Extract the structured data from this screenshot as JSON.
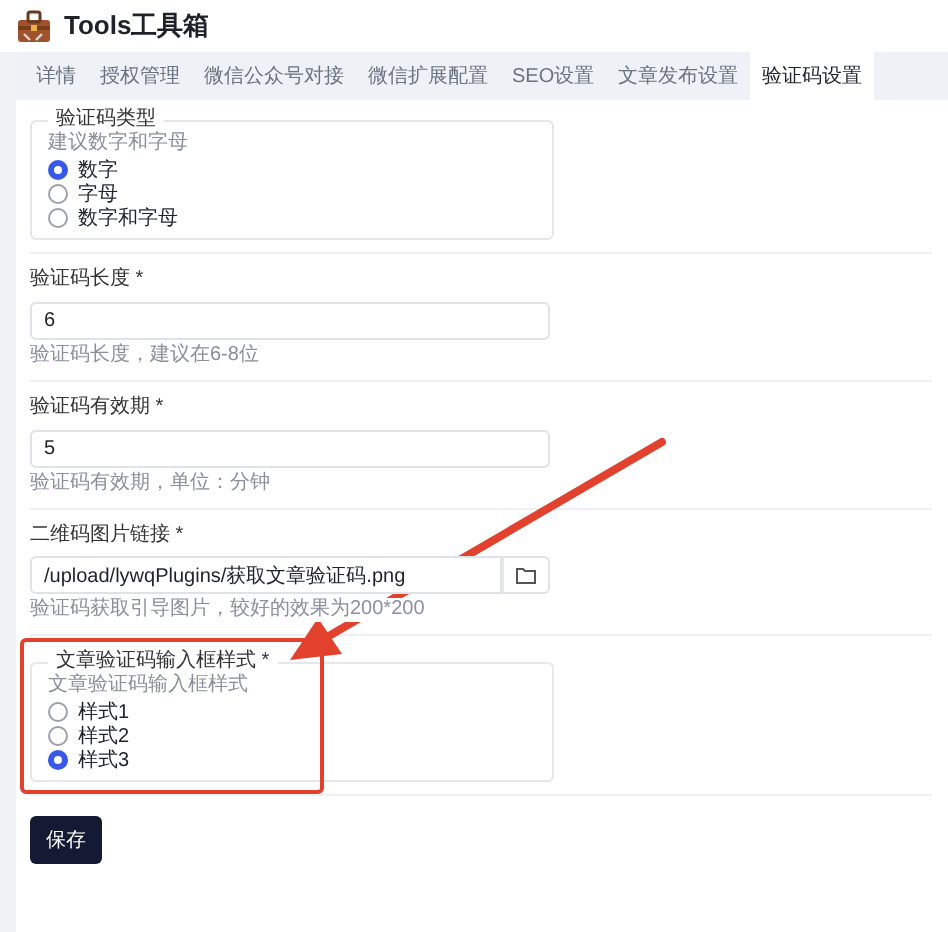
{
  "app": {
    "title": "Tools工具箱"
  },
  "tabs": [
    {
      "label": "详情",
      "selected": false
    },
    {
      "label": "授权管理",
      "selected": false
    },
    {
      "label": "微信公众号对接",
      "selected": false
    },
    {
      "label": "微信扩展配置",
      "selected": false
    },
    {
      "label": "SEO设置",
      "selected": false
    },
    {
      "label": "文章发布设置",
      "selected": false
    },
    {
      "label": "验证码设置",
      "selected": true
    }
  ],
  "sections": [
    {
      "kind": "radio-group",
      "legend": "验证码类型",
      "hint": "建议数字和字母",
      "options": [
        {
          "label": "数字",
          "selected": true
        },
        {
          "label": "字母",
          "selected": false
        },
        {
          "label": "数字和字母",
          "selected": false
        }
      ]
    },
    {
      "kind": "text",
      "label": "验证码长度 *",
      "value": "6",
      "help": "验证码长度，建议在6-8位"
    },
    {
      "kind": "text",
      "label": "验证码有效期 *",
      "value": "5",
      "help": "验证码有效期，单位：分钟"
    },
    {
      "kind": "file",
      "label": "二维码图片链接 *",
      "value": "/upload/lywqPlugins/获取文章验证码.png",
      "help": "验证码获取引导图片，较好的效果为200*200"
    },
    {
      "kind": "radio-group",
      "legend": "文章验证码输入框样式 *",
      "hint": "文章验证码输入框样式",
      "highlighted": true,
      "options": [
        {
          "label": "样式1",
          "selected": false
        },
        {
          "label": "样式2",
          "selected": false
        },
        {
          "label": "样式3",
          "selected": true
        }
      ]
    }
  ],
  "buttons": [
    {
      "label": "保存"
    }
  ]
}
